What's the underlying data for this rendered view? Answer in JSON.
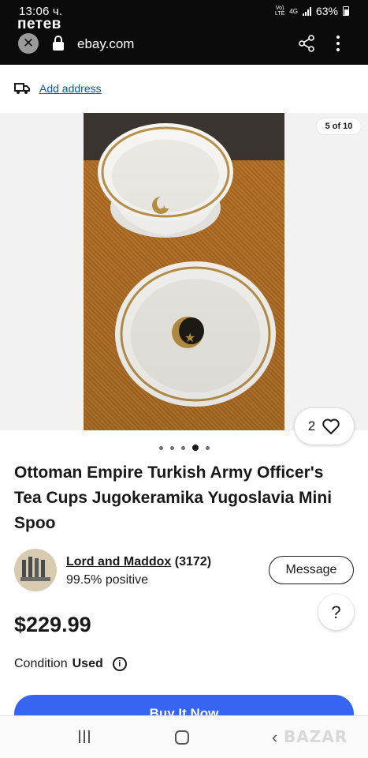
{
  "status_bar": {
    "time": "13:06 ч.",
    "network_top": "Vo)",
    "network_bottom": "LTE",
    "network_type": "4G",
    "battery": "63%"
  },
  "browser": {
    "tab_title": "петев",
    "url": "ebay.com"
  },
  "shipping": {
    "add_address_label": "Add address"
  },
  "gallery": {
    "counter": "5 of 10",
    "watch_count": "2",
    "dots_total": 5,
    "active_dot": 4
  },
  "listing": {
    "title": "Ottoman Empire Turkish Army Officer's Tea Cups Jugokeramika Yugoslavia Mini Spoo",
    "price": "$229.99",
    "condition_label": "Condition",
    "condition_value": "Used",
    "buy_label": "Buy It Now"
  },
  "seller": {
    "name": "Lord and Maddox",
    "score": "(3172)",
    "feedback": "99.5% positive",
    "message_label": "Message"
  },
  "help": {
    "label": "?"
  },
  "watermark": "BAZAR",
  "colors": {
    "ebay_blue": "#3665f3",
    "link_blue": "#0654ba",
    "chrome_black": "#0b0b0b"
  }
}
